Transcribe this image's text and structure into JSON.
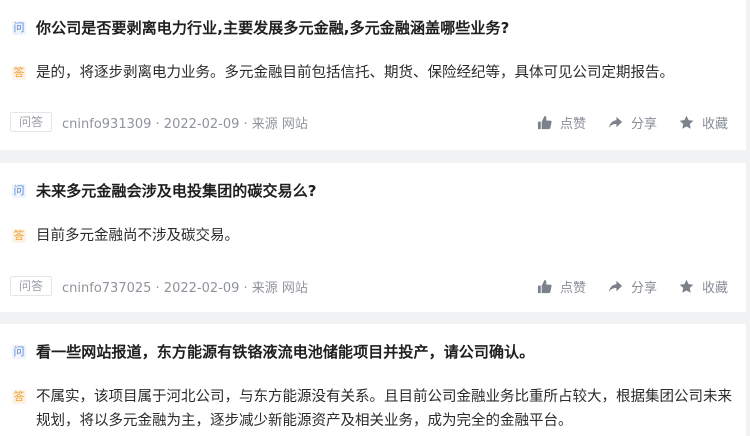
{
  "qa_items": [
    {
      "question_tag": "问",
      "question": "你公司是否要剥离电力行业,主要发展多元金融,多元金融涵盖哪些业务?",
      "answer_tag": "答",
      "answer": "是的，将逐步剥离电力业务。多元金融目前包括信托、期货、保险经纪等，具体可见公司定期报告。",
      "category": "问答",
      "meta": "cninfo931309 · 2022-02-09 · 来源 网站",
      "like_label": "点赞",
      "share_label": "分享",
      "favorite_label": "收藏"
    },
    {
      "question_tag": "问",
      "question": "未来多元金融会涉及电投集团的碳交易么?",
      "answer_tag": "答",
      "answer": "目前多元金融尚不涉及碳交易。",
      "category": "问答",
      "meta": "cninfo737025 · 2022-02-09 · 来源 网站",
      "like_label": "点赞",
      "share_label": "分享",
      "favorite_label": "收藏"
    },
    {
      "question_tag": "问",
      "question": "看一些网站报道，东方能源有铁铬液流电池储能项目并投产，请公司确认。",
      "answer_tag": "答",
      "answer": "不属实，该项目属于河北公司，与东方能源没有关系。且目前公司金融业务比重所占较大，根据集团公司未来规划，将以多元金融为主，逐步减少新能源资产及相关业务，成为完全的金融平台。"
    }
  ],
  "icons": {
    "like": "thumbs-up-icon",
    "share": "share-arrow-icon",
    "favorite": "star-icon"
  },
  "colors": {
    "question_tag": "#5b8ad8",
    "answer_tag": "#f0a23a",
    "page_background": "#f1f2f4",
    "muted_text": "#8f949c"
  }
}
